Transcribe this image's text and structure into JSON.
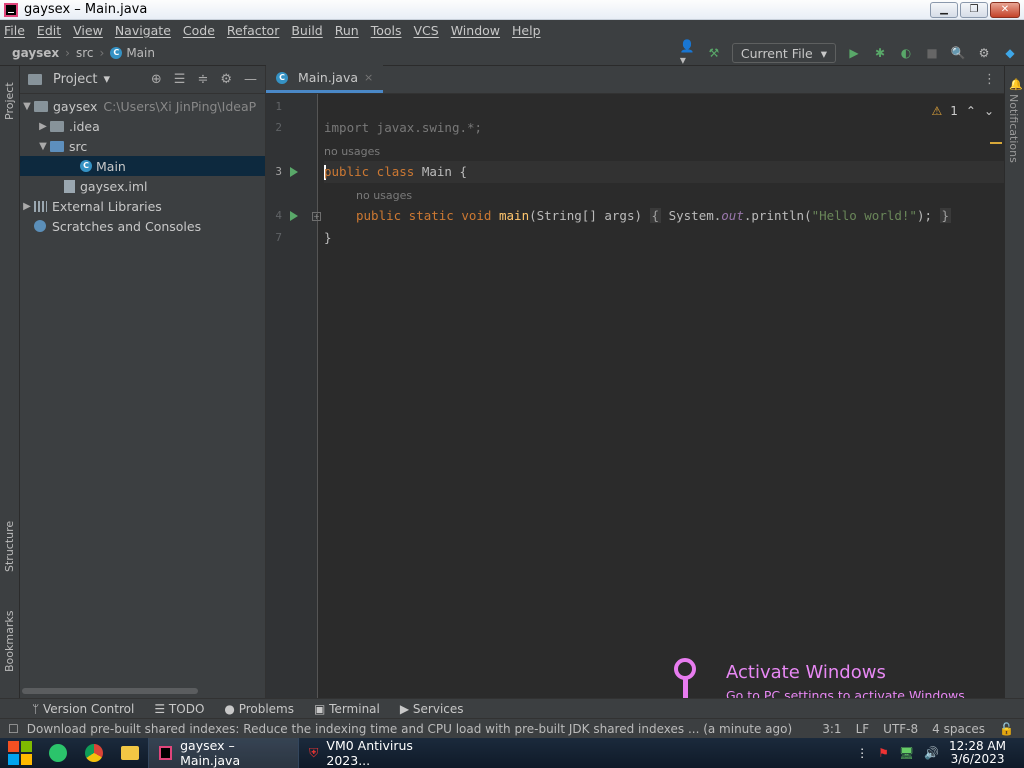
{
  "window": {
    "title": "gaysex – Main.java",
    "min": "▁",
    "max": "❐",
    "close": "✕"
  },
  "menu": [
    "File",
    "Edit",
    "View",
    "Navigate",
    "Code",
    "Refactor",
    "Build",
    "Run",
    "Tools",
    "VCS",
    "Window",
    "Help"
  ],
  "breadcrumb": {
    "project": "gaysex",
    "folder": "src",
    "file": "Main"
  },
  "toolbar": {
    "run_config": "Current File"
  },
  "left_stripe": {
    "project": "Project",
    "structure": "Structure",
    "bookmarks": "Bookmarks"
  },
  "right_stripe": {
    "notifications": "Notifications"
  },
  "project_panel": {
    "title": "Project",
    "tree": [
      {
        "label": "gaysex",
        "path": "C:\\Users\\Xi JinPing\\IdeaP"
      },
      {
        "label": ".idea"
      },
      {
        "label": "src"
      },
      {
        "label": "Main"
      },
      {
        "label": "gaysex.iml"
      },
      {
        "label": "External Libraries"
      },
      {
        "label": "Scratches and Consoles"
      }
    ]
  },
  "editor": {
    "tab": "Main.java",
    "warnings": "1",
    "line_numbers": [
      "1",
      "2",
      "3",
      "4",
      "7"
    ],
    "lines": {
      "l2_kw": "import",
      "l2_rest": " javax.swing.*;",
      "hint1": "no usages",
      "l3_kw": "ublic class",
      "l3_p": "p",
      "l3_rest": " Main {",
      "hint2": "no usages",
      "l4_kw": "public static void",
      "l4_fn": "main",
      "l4_args": "(String[] args) ",
      "l4_open": "{",
      "l4_body1": " System.",
      "l4_out": "out",
      "l4_body2": ".println(",
      "l4_str": "\"Hello world!\"",
      "l4_end": ");",
      "l4_close": "}",
      "l7": "}"
    }
  },
  "activation": {
    "title": "Activate Windows",
    "subtitle": "Go to PC settings to activate Windows."
  },
  "tool_windows": [
    "Version Control",
    "TODO",
    "Problems",
    "Terminal",
    "Services"
  ],
  "status": {
    "message": "Download pre-built shared indexes: Reduce the indexing time and CPU load with pre-built JDK shared indexes ... (a minute ago)",
    "position": "3:1",
    "line_sep": "LF",
    "encoding": "UTF-8",
    "indent": "4 spaces"
  },
  "taskbar": {
    "tasks": [
      "gaysex – Main.java",
      "VM0 Antivirus 2023..."
    ],
    "time": "12:28 AM",
    "date": "3/6/2023"
  }
}
